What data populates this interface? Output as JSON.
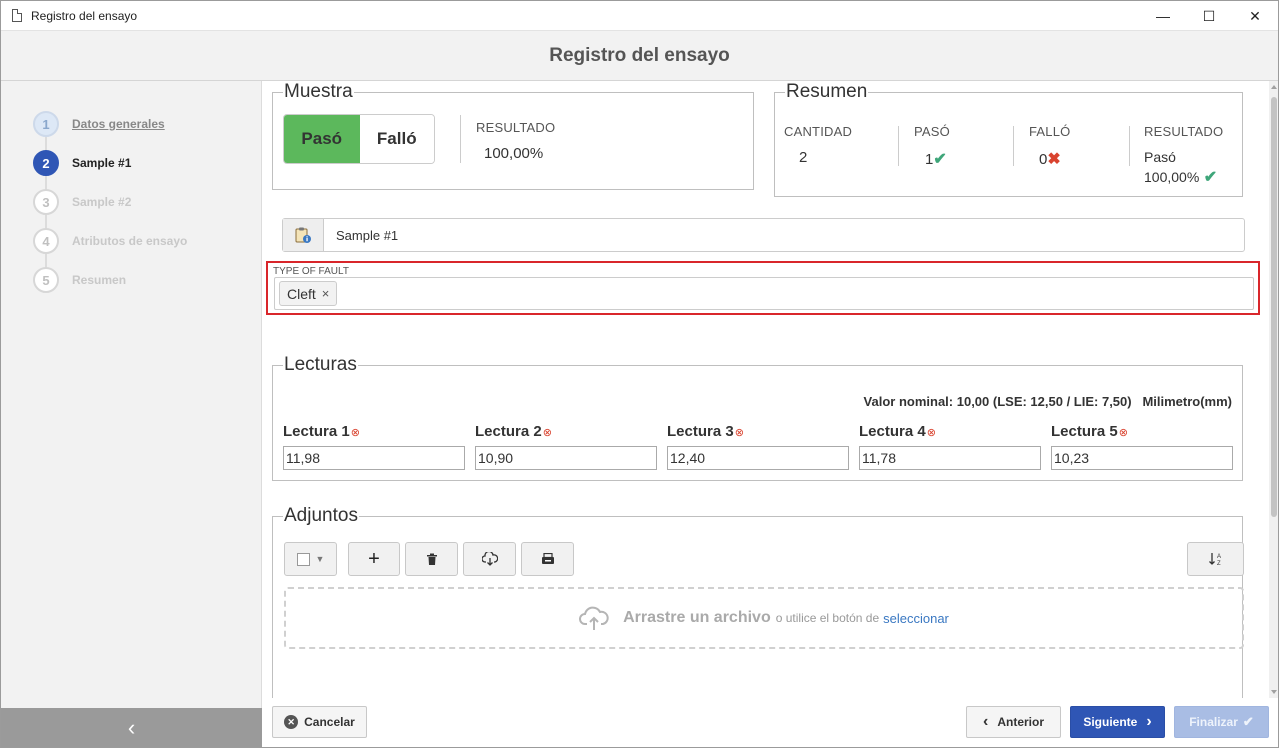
{
  "window": {
    "title": "Registro del ensayo",
    "minimize": "—",
    "maximize": "☐",
    "close": "✕"
  },
  "header": {
    "title": "Registro del ensayo"
  },
  "steps": [
    {
      "num": "1",
      "label": "Datos generales"
    },
    {
      "num": "2",
      "label": "Sample #1"
    },
    {
      "num": "3",
      "label": "Sample #2"
    },
    {
      "num": "4",
      "label": "Atributos de ensayo"
    },
    {
      "num": "5",
      "label": "Resumen"
    }
  ],
  "sidebar": {
    "collapse_icon": "‹"
  },
  "muestra": {
    "legend": "Muestra",
    "pass_label": "Pasó",
    "fail_label": "Falló",
    "result_label": "RESULTADO",
    "result_value": "100,00%"
  },
  "resumen": {
    "legend": "Resumen",
    "qty_label": "CANTIDAD",
    "qty_value": "2",
    "pass_label": "PASÓ",
    "pass_value": "1",
    "fail_label": "FALLÓ",
    "fail_value": "0",
    "result_label": "RESULTADO",
    "result_line1": "Pasó",
    "result_line2": "100,00%"
  },
  "sample": {
    "name": "Sample #1"
  },
  "fault": {
    "label": "TYPE OF FAULT",
    "chip": "Cleft",
    "chip_remove": "×"
  },
  "lecturas": {
    "legend": "Lecturas",
    "nominal": "Valor nominal: 10,00 (LSE: 12,50 / LIE: 7,50)",
    "unit": "Milimetro(mm)",
    "readings": [
      {
        "label": "Lectura 1",
        "value": "11,98"
      },
      {
        "label": "Lectura 2",
        "value": "10,90"
      },
      {
        "label": "Lectura 3",
        "value": "12,40"
      },
      {
        "label": "Lectura 4",
        "value": "11,78"
      },
      {
        "label": "Lectura 5",
        "value": "10,23"
      }
    ]
  },
  "adjuntos": {
    "legend": "Adjuntos",
    "drop_big": "Arrastre un archivo",
    "drop_small": "o utilice el botón de",
    "drop_link": "seleccionar"
  },
  "footer": {
    "cancel": "Cancelar",
    "prev": "Anterior",
    "next": "Siguiente",
    "finish": "Finalizar"
  },
  "colors": {
    "accent": "#2f56b5",
    "pass": "#5cb85c",
    "error": "#d9262b"
  }
}
